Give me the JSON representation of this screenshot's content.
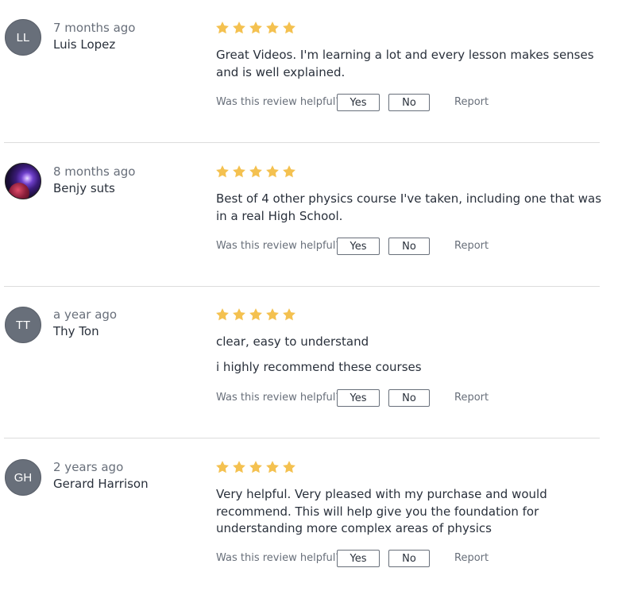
{
  "colors": {
    "star": "#f4c150",
    "avatar_bg": "#686f7a",
    "text": "#29303b",
    "muted": "#686f7a",
    "divider": "#dcdcdc"
  },
  "helpful_prompt": "Was this review helpful?",
  "yes_label": "Yes",
  "no_label": "No",
  "report_label": "Report",
  "reviews": [
    {
      "initials": "LL",
      "time": "7 months ago",
      "name": "Luis Lopez",
      "rating": 5,
      "text": [
        "Great Videos. I'm learning a lot and every lesson makes senses and is well explained."
      ]
    },
    {
      "initials": "",
      "avatar_image": "space-photo",
      "time": "8 months ago",
      "name": "Benjy suts",
      "rating": 5,
      "text": [
        "Best of 4 other physics course I've taken, including one that was in a real High School."
      ]
    },
    {
      "initials": "TT",
      "time": "a year ago",
      "name": "Thy Ton",
      "rating": 5,
      "text": [
        "clear, easy to understand",
        "i highly recommend these courses"
      ]
    },
    {
      "initials": "GH",
      "time": "2 years ago",
      "name": "Gerard Harrison",
      "rating": 5,
      "text": [
        "Very helpful. Very pleased with my purchase and would recommend. This will help give you the foundation for understanding more complex areas of physics"
      ]
    }
  ]
}
